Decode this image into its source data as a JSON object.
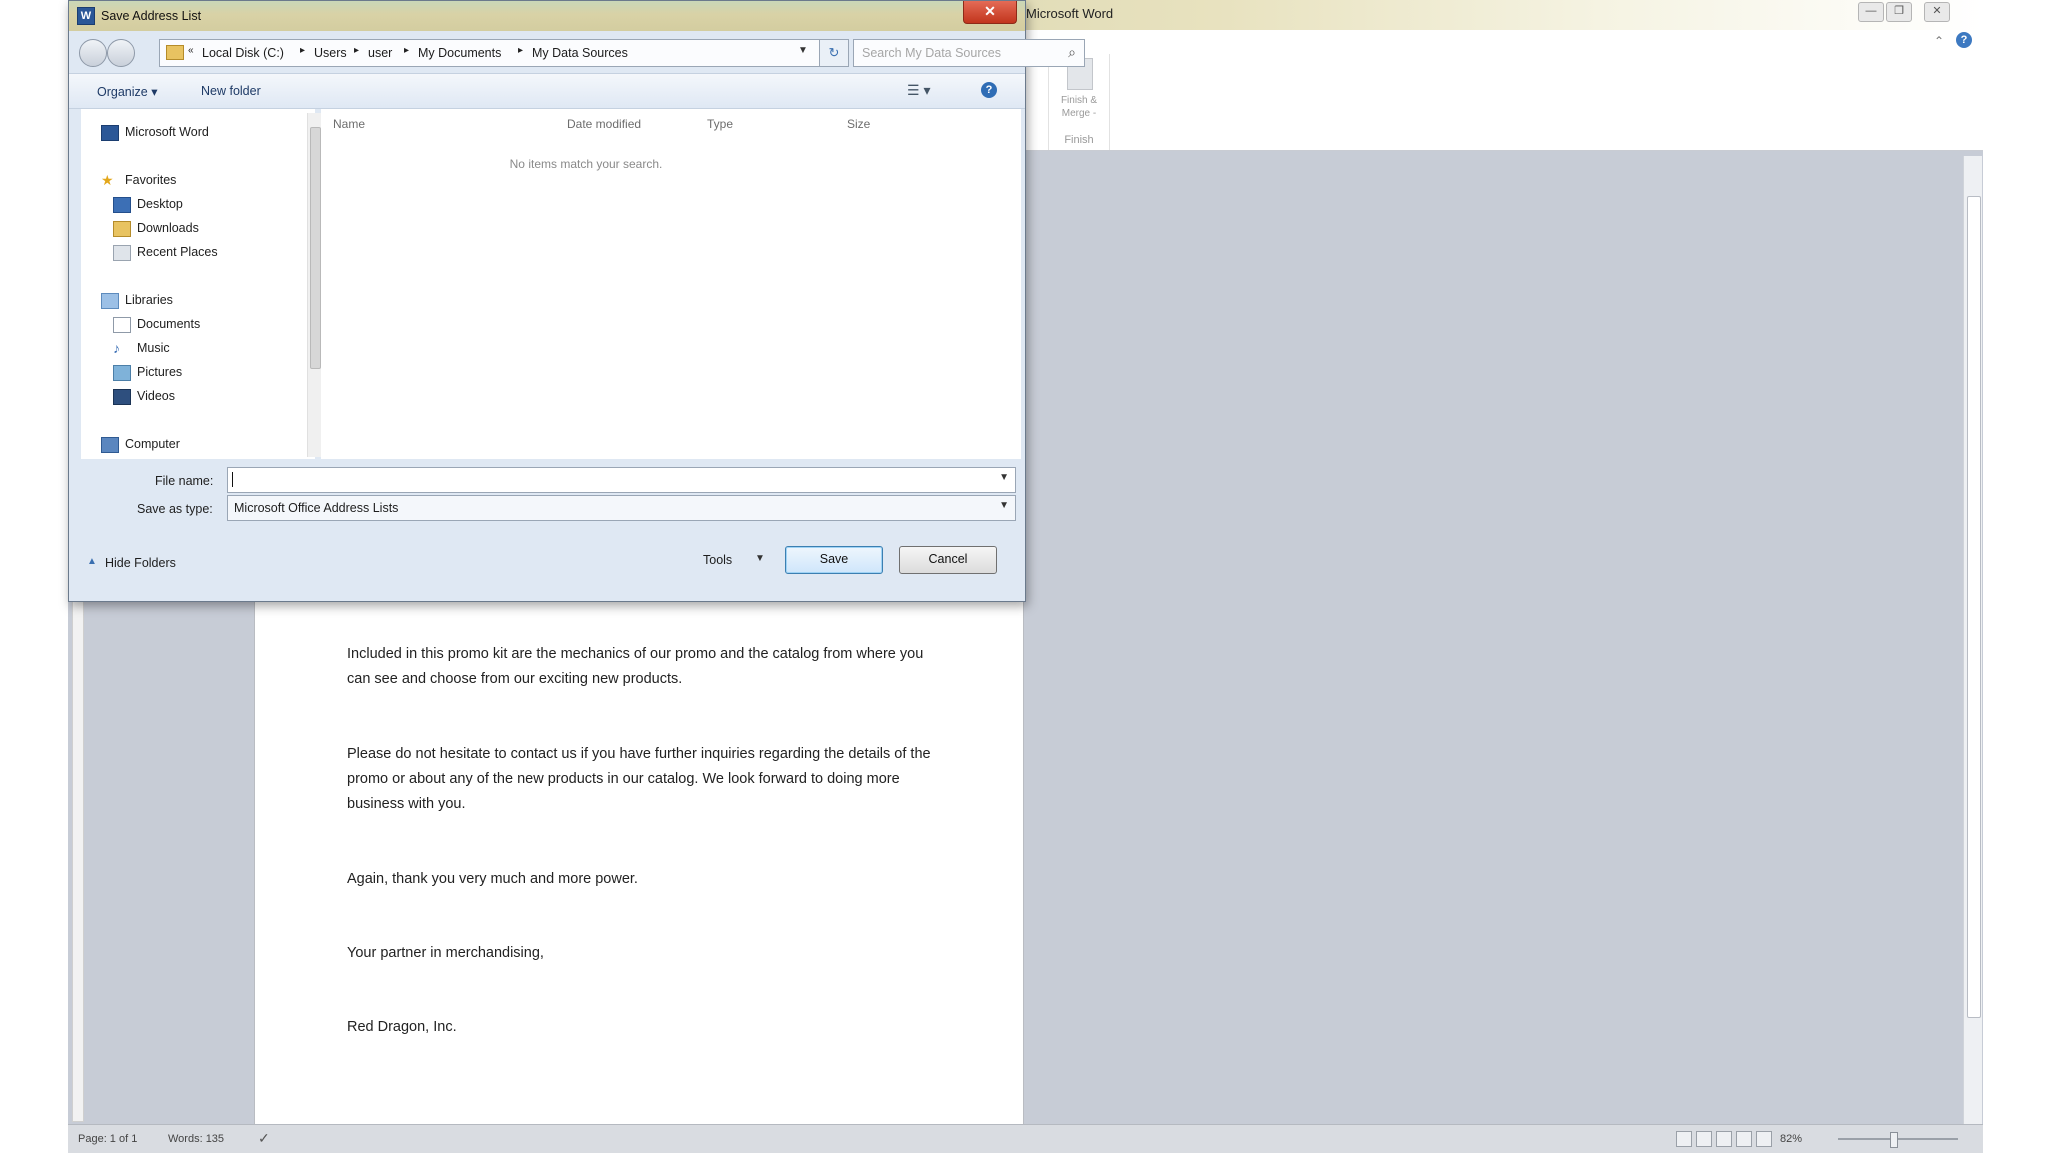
{
  "word": {
    "title": "Microsoft Word",
    "ribbon": {
      "finish_merge": "Finish &\nMerge -",
      "finish_group": "Finish"
    },
    "document": {
      "paragraphs": [
        "Included in this promo kit are the mechanics of our promo and the catalog from where you can see and choose from our exciting new products.",
        "Please do not hesitate to contact us if you have further inquiries regarding the details of the promo or about any of the new products in our catalog.  We look forward to doing more business with you.",
        "Again, thank you very much and more power.",
        "Your partner in merchandising,",
        "Red Dragon, Inc."
      ]
    },
    "status": {
      "page": "Page: 1 of 1",
      "words": "Words: 135",
      "zoom": "82%"
    }
  },
  "dialog": {
    "title": "Save Address List",
    "app_icon_letter": "W",
    "close_glyph": "✕",
    "address": {
      "crumbs": [
        "Local Disk (C:)",
        "Users",
        "user",
        "My Documents",
        "My Data Sources"
      ]
    },
    "search_placeholder": "Search My Data Sources",
    "commands": {
      "organize": "Organize ▾",
      "new_folder": "New folder"
    },
    "nav": {
      "microsoft_word": "Microsoft Word",
      "favorites": "Favorites",
      "desktop": "Desktop",
      "downloads": "Downloads",
      "recent_places": "Recent Places",
      "libraries": "Libraries",
      "documents": "Documents",
      "music": "Music",
      "pictures": "Pictures",
      "videos": "Videos",
      "computer": "Computer"
    },
    "columns": {
      "name": "Name",
      "date_modified": "Date modified",
      "type": "Type",
      "size": "Size"
    },
    "empty_message": "No items match your search.",
    "file_name_label": "File name:",
    "file_name_value": "",
    "save_type_label": "Save as type:",
    "save_type_value": "Microsoft Office Address Lists",
    "hide_folders": "Hide Folders",
    "tools": "Tools",
    "save": "Save",
    "cancel": "Cancel"
  }
}
